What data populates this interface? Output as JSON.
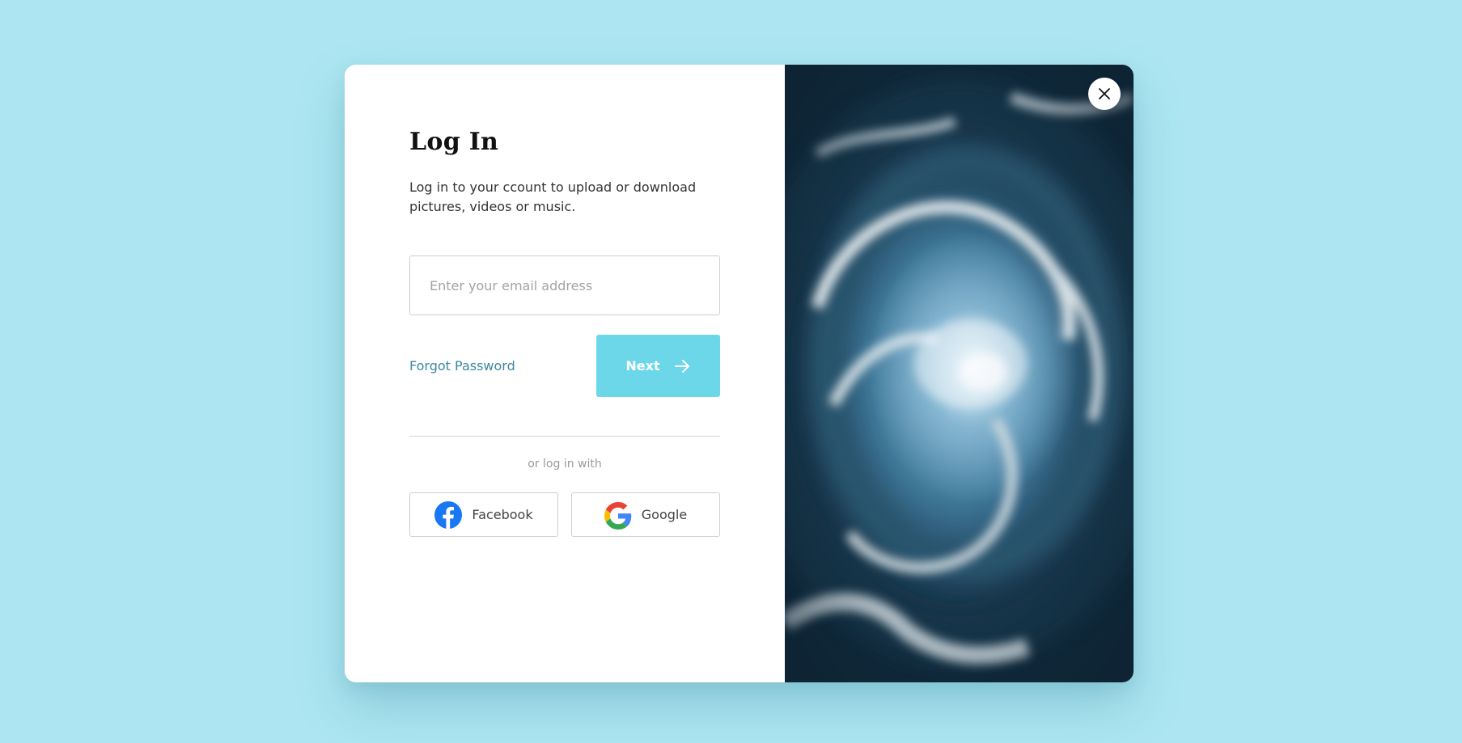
{
  "login": {
    "title": "Log In",
    "subtitle": "Log in to your ccount to upload or download pictures, videos or music.",
    "email_placeholder": "Enter your email address",
    "email_value": "",
    "forgot_password_label": "Forgot Password",
    "next_label": "Next",
    "or_text": "or log in with",
    "social": {
      "facebook_label": "Facebook",
      "google_label": "Google"
    }
  },
  "colors": {
    "page_background": "#ade6f2",
    "accent": "#6dd7ea",
    "link": "#3d87a0",
    "facebook_blue": "#1877f2"
  },
  "icons": {
    "next": "arrow-right-icon",
    "close": "close-icon",
    "facebook": "facebook-icon",
    "google": "google-icon"
  }
}
